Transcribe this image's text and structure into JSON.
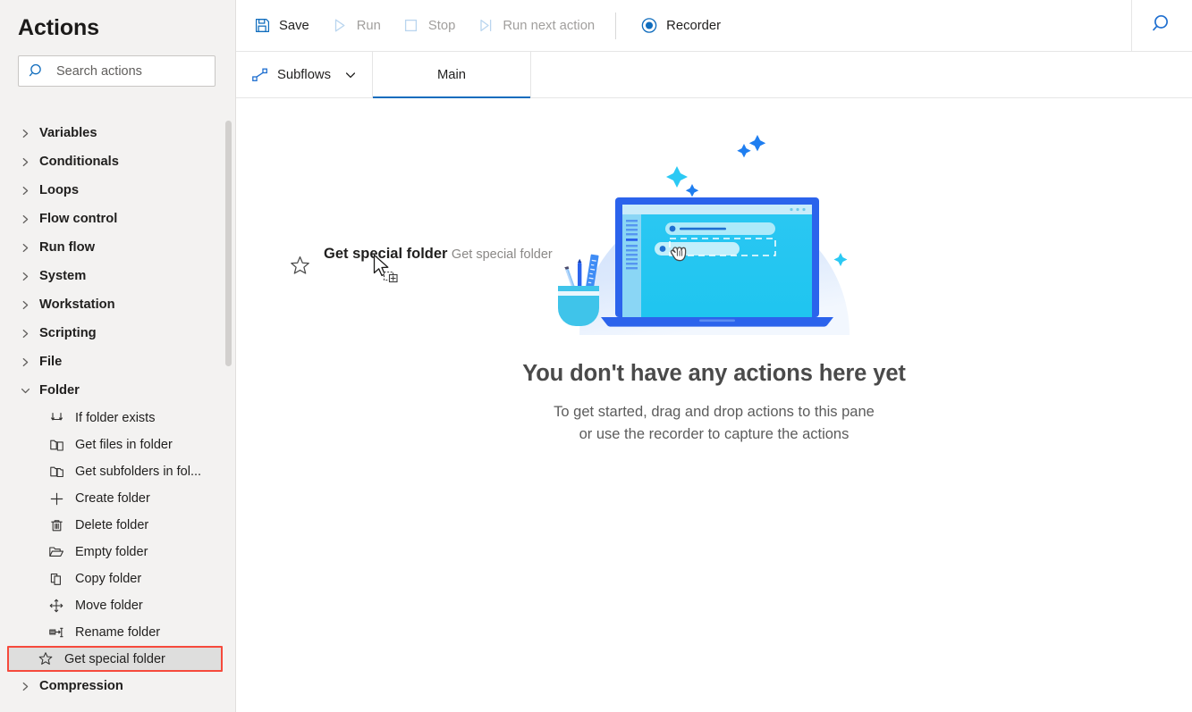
{
  "sidebar": {
    "title": "Actions",
    "search": {
      "placeholder": "Search actions",
      "value": "",
      "icon": "search-icon"
    },
    "categories": [
      {
        "label": "Variables",
        "expanded": false,
        "icon": "chevron-right-icon"
      },
      {
        "label": "Conditionals",
        "expanded": false,
        "icon": "chevron-right-icon"
      },
      {
        "label": "Loops",
        "expanded": false,
        "icon": "chevron-right-icon"
      },
      {
        "label": "Flow control",
        "expanded": false,
        "icon": "chevron-right-icon"
      },
      {
        "label": "Run flow",
        "expanded": false,
        "icon": "chevron-right-icon"
      },
      {
        "label": "System",
        "expanded": false,
        "icon": "chevron-right-icon"
      },
      {
        "label": "Workstation",
        "expanded": false,
        "icon": "chevron-right-icon"
      },
      {
        "label": "Scripting",
        "expanded": false,
        "icon": "chevron-right-icon"
      },
      {
        "label": "File",
        "expanded": false,
        "icon": "chevron-right-icon"
      },
      {
        "label": "Folder",
        "expanded": true,
        "icon": "chevron-down-icon"
      }
    ],
    "folder_actions": [
      {
        "label": "If folder exists",
        "icon": "branch-icon",
        "selected": false
      },
      {
        "label": "Get files in folder",
        "icon": "folder-files-icon",
        "selected": false
      },
      {
        "label": "Get subfolders in fol...",
        "icon": "subfolders-icon",
        "selected": false
      },
      {
        "label": "Create folder",
        "icon": "plus-icon",
        "selected": false
      },
      {
        "label": "Delete folder",
        "icon": "trash-icon",
        "selected": false
      },
      {
        "label": "Empty folder",
        "icon": "open-folder-icon",
        "selected": false
      },
      {
        "label": "Copy folder",
        "icon": "copy-icon",
        "selected": false
      },
      {
        "label": "Move folder",
        "icon": "move-arrows-icon",
        "selected": false
      },
      {
        "label": "Rename folder",
        "icon": "rename-icon",
        "selected": false
      },
      {
        "label": "Get special folder",
        "icon": "star-icon",
        "selected": true
      }
    ],
    "trailing_categories": [
      {
        "label": "Compression",
        "expanded": false,
        "icon": "chevron-right-icon"
      }
    ],
    "highlight_color": "#f64a3c",
    "selected_row_bg": "#dededd"
  },
  "toolbar": {
    "buttons": [
      {
        "label": "Save",
        "icon": "save-icon",
        "disabled": false
      },
      {
        "label": "Run",
        "icon": "play-icon",
        "disabled": true
      },
      {
        "label": "Stop",
        "icon": "stop-icon",
        "disabled": true
      },
      {
        "label": "Run next action",
        "icon": "step-over-icon",
        "disabled": true
      }
    ],
    "recorder": {
      "label": "Recorder",
      "icon": "record-icon"
    },
    "search_icon": "search-icon",
    "accent_color": "#0f6cbd"
  },
  "tabbar": {
    "subflows": {
      "label": "Subflows",
      "icon": "subflows-icon",
      "chevron": "chevron-down-icon"
    },
    "tabs": [
      {
        "label": "Main",
        "active": true
      }
    ]
  },
  "canvas": {
    "drag_item": {
      "title": "Get special folder",
      "subtitle": "Get special folder",
      "icon": "star-icon",
      "cursor": "drag-copy-cursor"
    },
    "empty_state": {
      "illustration": "laptop-drag-drop-illustration",
      "title": "You don't have any actions here yet",
      "line1": "To get started, drag and drop actions to this pane",
      "line2": "or use the recorder to capture the actions"
    }
  }
}
